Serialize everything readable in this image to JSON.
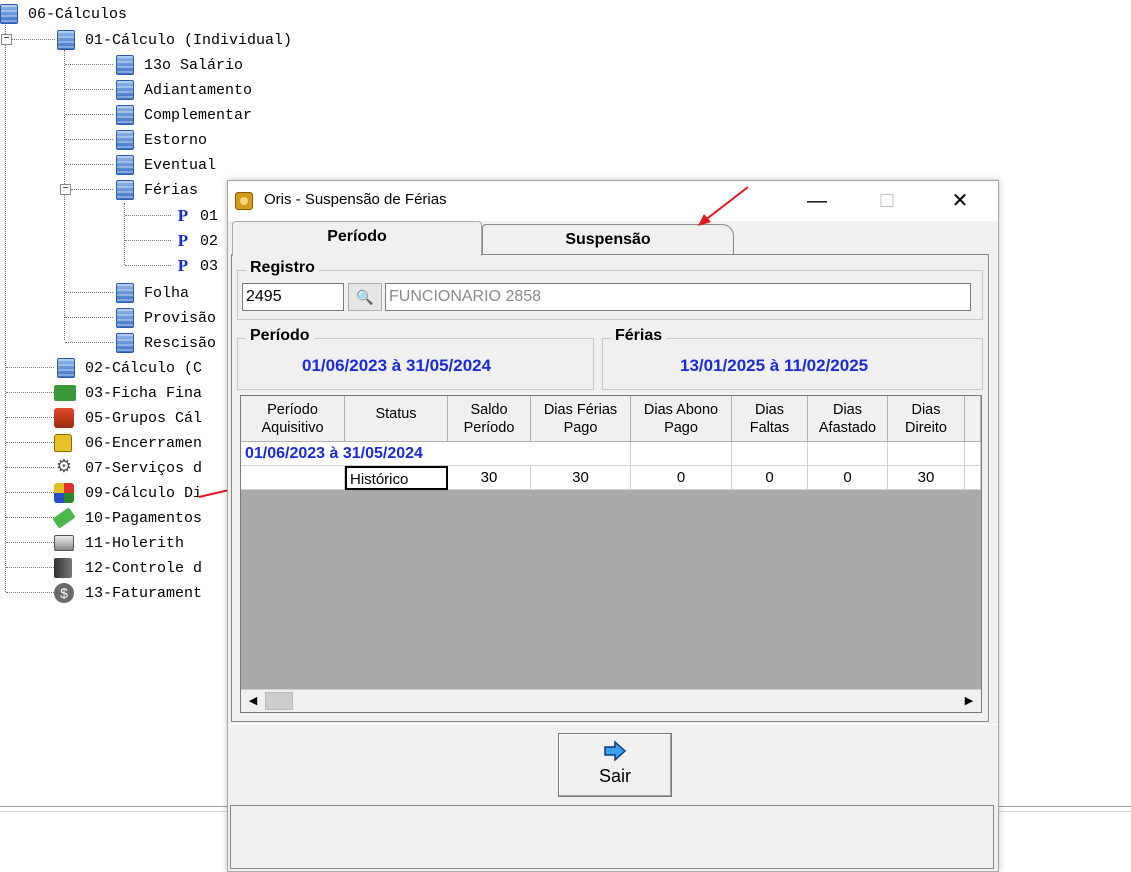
{
  "tree": {
    "root": "06-Cálculos",
    "calc_individual": "01-Cálculo (Individual)",
    "children": [
      "13o Salário",
      "Adiantamento",
      "Complementar",
      "Estorno",
      "Eventual",
      "Férias"
    ],
    "ferias_children": [
      "01",
      "02",
      "03"
    ],
    "after_ferias": [
      "Folha",
      "Provisão",
      "Rescisão"
    ],
    "top_items": [
      "02-Cálculo (C",
      "03-Ficha Fina",
      "05-Grupos Cál",
      "06-Encerramen",
      "07-Serviços d",
      "09-Cálculo Di",
      "10-Pagamentos",
      "11-Holerith",
      "12-Controle d",
      "13-Faturament"
    ],
    "p_letter": "P"
  },
  "dialog": {
    "title": "Oris - Suspensão de Férias",
    "minimize": "—",
    "maximize": "☐",
    "close": "✕",
    "tabs": [
      "Período",
      "Suspensão"
    ],
    "registro_label": "Registro",
    "registro_value": "2495",
    "funcionario": "FUNCIONARIO 2858",
    "periodo_label": "Período",
    "periodo_value": "01/06/2023 à 31/05/2024",
    "ferias_label": "Férias",
    "ferias_value": "13/01/2025 à 11/02/2025",
    "grid": {
      "headers": [
        [
          "Período",
          "Aquisitivo"
        ],
        [
          "Status",
          ""
        ],
        [
          "Saldo",
          "Período"
        ],
        [
          "Dias Férias",
          "Pago"
        ],
        [
          "Dias Abono",
          "Pago"
        ],
        [
          "Dias",
          "Faltas"
        ],
        [
          "Dias",
          "Afastado"
        ],
        [
          "Dias",
          "Direito"
        ]
      ],
      "group_row": "01/06/2023 à 31/05/2024",
      "rows": [
        {
          "periodo": "",
          "status": "Histórico",
          "saldo": "30",
          "ferias_pago": "30",
          "abono_pago": "0",
          "faltas": "0",
          "afastado": "0",
          "direito": "30"
        }
      ]
    },
    "exit_label": "Sair"
  }
}
